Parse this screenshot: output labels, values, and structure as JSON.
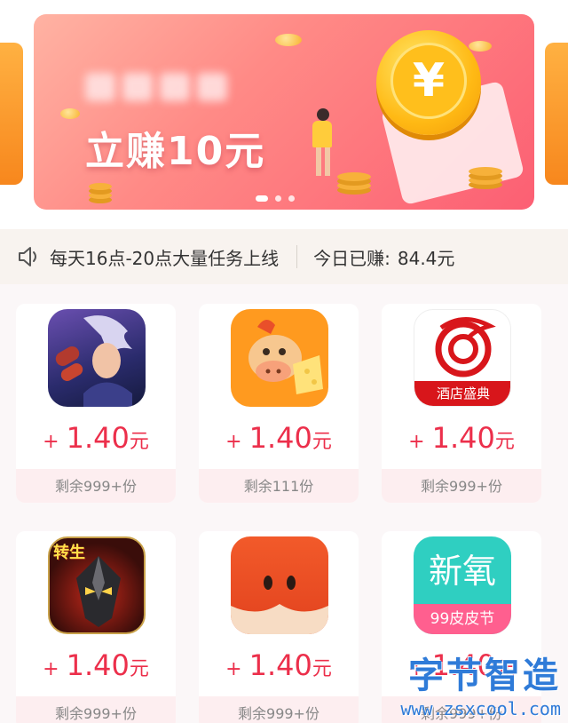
{
  "banner": {
    "title": "立赚10元",
    "coin_symbol": "¥",
    "slide_count": 3,
    "active_slide": 0
  },
  "notice": {
    "text": "每天16点-20点大量任务上线",
    "earned_label": "今日已赚:",
    "earned_value": "84.4元"
  },
  "tasks": [
    {
      "icon": "game-hero-icon",
      "icon_text": "",
      "plus": "+",
      "reward": "1.40",
      "unit": "元",
      "remaining": "剩余999+份"
    },
    {
      "icon": "cartoon-cow-icon",
      "icon_text": "",
      "plus": "+",
      "reward": "1.40",
      "unit": "元",
      "remaining": "剩余111份"
    },
    {
      "icon": "hotel-app-icon",
      "icon_text": "酒店盛典",
      "plus": "+",
      "reward": "1.40",
      "unit": "元",
      "remaining": "剩余999+份"
    },
    {
      "icon": "rebirth-game-icon",
      "icon_text": "转生",
      "plus": "+",
      "reward": "1.40",
      "unit": "元",
      "remaining": "剩余999+份"
    },
    {
      "icon": "fox-app-icon",
      "icon_text": "",
      "plus": "+",
      "reward": "1.40",
      "unit": "元",
      "remaining": "剩余999+份"
    },
    {
      "icon": "xinyang-app-icon",
      "icon_text": "新氧",
      "icon_subtext": "99皮皮节",
      "plus": "+",
      "reward": "1.40",
      "unit": "元",
      "remaining": "剩余999+份"
    }
  ],
  "watermark": {
    "title": "字节智造",
    "url": "www.zsxcool.com"
  },
  "colors": {
    "accent": "#ec2f4b",
    "banner_start": "#ffb3a3",
    "banner_end": "#fc5f73",
    "remain_bg": "#fdeef0"
  }
}
